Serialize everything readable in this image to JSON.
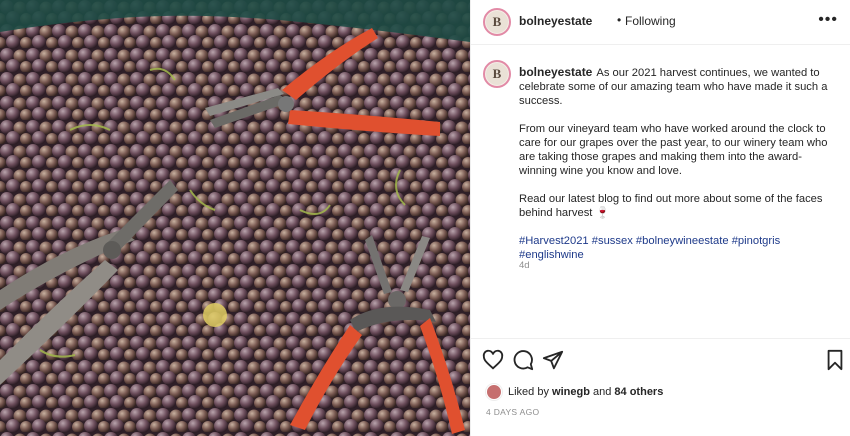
{
  "post": {
    "username": "bolneyestate",
    "separator": "•",
    "follow_status": "Following",
    "more_label": "•••",
    "avatar_letter": "B",
    "image_alt": "Grapes and pruning shears"
  },
  "caption": {
    "username": "bolneyestate",
    "paragraph1": "As our 2021 harvest continues, we wanted to celebrate some of our amazing team who have made it such a success.",
    "paragraph2": "From our vineyard team who have worked around the clock to care for our grapes over the past year, to our winery team who are taking those grapes and making them into the award-winning wine you know and love.",
    "paragraph3": "Read our latest blog to find out more about some of the faces behind harvest 🍷",
    "hashtags": "#Harvest2021 #sussex #bolneywineestate #pinotgris #englishwine",
    "time_ago": "4d"
  },
  "engagement": {
    "liked_by_prefix": "Liked by",
    "liked_by_user": "winegb",
    "and": "and",
    "others": "84 others",
    "date": "4 DAYS AGO"
  },
  "icons": {
    "heart": "heart-icon",
    "comment": "comment-icon",
    "share": "share-icon",
    "save": "bookmark-icon"
  }
}
